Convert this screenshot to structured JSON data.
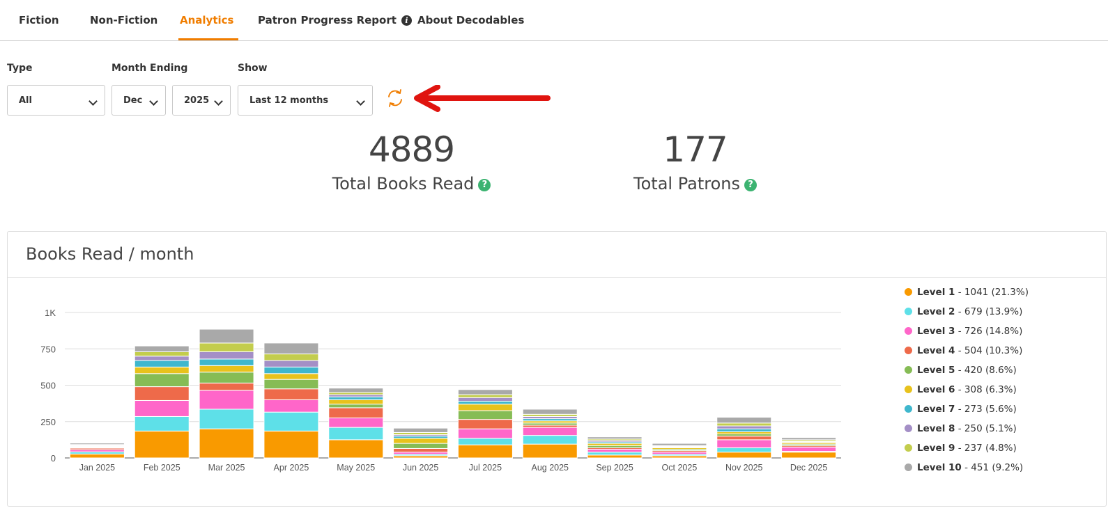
{
  "tabs": [
    {
      "label": "Fiction"
    },
    {
      "label": "Non-Fiction"
    },
    {
      "label": "Analytics",
      "active": true
    },
    {
      "label": "Patron Progress Report"
    },
    {
      "label": "About Decodables"
    }
  ],
  "filters": {
    "type_label": "Type",
    "type_value": "All",
    "month_label": "Month Ending",
    "month_value": "Dec",
    "year_value": "2025",
    "show_label": "Show",
    "show_value": "Last 12 months"
  },
  "stats": {
    "books": {
      "value": "4889",
      "label": "Total Books Read"
    },
    "patrons": {
      "value": "177",
      "label": "Total Patrons"
    }
  },
  "card": {
    "title": "Books Read / month"
  },
  "colors": {
    "accent": "#f07d00",
    "arrow": "#e0140f",
    "help": "#3cb371",
    "levels": [
      "#f99a00",
      "#5ee0e8",
      "#ff66c9",
      "#ee6a4a",
      "#86bc55",
      "#e8c21c",
      "#3fb7cd",
      "#a48fc6",
      "#c3cd4d",
      "#a9a9a9"
    ]
  },
  "chart_data": {
    "type": "bar",
    "stacked": true,
    "categories": [
      "Jan 2025",
      "Feb 2025",
      "Mar 2025",
      "Apr 2025",
      "May 2025",
      "Jun 2025",
      "Jul 2025",
      "Aug 2025",
      "Sep 2025",
      "Oct 2025",
      "Nov 2025",
      "Dec 2025"
    ],
    "ylim": [
      0,
      1000
    ],
    "yticks": [
      0,
      250,
      500,
      750,
      1000
    ],
    "ytick_labels": [
      "0",
      "250",
      "500",
      "750",
      "1K"
    ],
    "grid": true,
    "legend_position": "right",
    "series": [
      {
        "name": "Level 1",
        "legend": "- 1041 (21.3%)",
        "values": [
          27,
          185,
          200,
          185,
          125,
          15,
          90,
          95,
          20,
          15,
          40,
          40
        ]
      },
      {
        "name": "Level 2",
        "legend": "- 679 (13.9%)",
        "values": [
          15,
          100,
          135,
          130,
          85,
          10,
          45,
          60,
          20,
          10,
          30,
          5
        ]
      },
      {
        "name": "Level 3",
        "legend": "- 726 (14.8%)",
        "values": [
          15,
          110,
          130,
          85,
          65,
          15,
          65,
          55,
          20,
          15,
          55,
          30
        ]
      },
      {
        "name": "Level 4",
        "legend": "- 504 (10.3%)",
        "values": [
          10,
          95,
          50,
          75,
          70,
          25,
          65,
          15,
          10,
          10,
          25,
          10
        ]
      },
      {
        "name": "Level 5",
        "legend": "- 420 (8.6%)",
        "values": [
          5,
          90,
          75,
          65,
          25,
          35,
          60,
          15,
          15,
          10,
          15,
          10
        ]
      },
      {
        "name": "Level 6",
        "legend": "- 308 (6.3%)",
        "values": [
          5,
          45,
          45,
          40,
          30,
          35,
          45,
          15,
          15,
          10,
          15,
          10
        ]
      },
      {
        "name": "Level 7",
        "legend": "- 273 (5.6%)",
        "values": [
          5,
          45,
          45,
          45,
          20,
          15,
          20,
          15,
          10,
          5,
          20,
          5
        ]
      },
      {
        "name": "Level 8",
        "legend": "- 250 (5.1%)",
        "values": [
          5,
          30,
          50,
          45,
          15,
          10,
          25,
          15,
          10,
          5,
          20,
          5
        ]
      },
      {
        "name": "Level 9",
        "legend": "- 237 (4.8%)",
        "values": [
          5,
          30,
          60,
          45,
          15,
          15,
          20,
          15,
          10,
          5,
          20,
          10
        ]
      },
      {
        "name": "Level 10",
        "legend": "- 451 (9.2%)",
        "values": [
          10,
          40,
          95,
          75,
          30,
          30,
          35,
          35,
          15,
          15,
          40,
          15
        ]
      }
    ]
  }
}
